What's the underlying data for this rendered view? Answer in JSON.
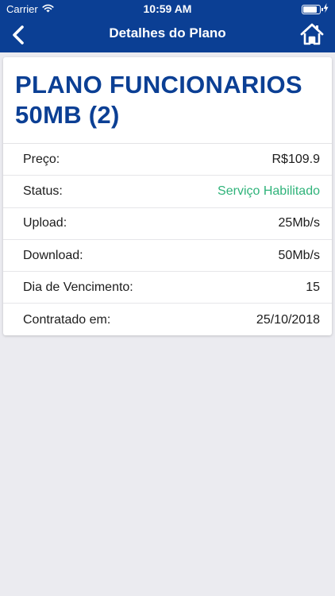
{
  "status_bar": {
    "carrier": "Carrier",
    "time": "10:59 AM"
  },
  "nav": {
    "title": "Detalhes do Plano",
    "back_icon": "chevron-left-icon",
    "home_icon": "home-icon"
  },
  "plan": {
    "title": "PLANO FUNCIONARIOS 50MB (2)",
    "details": [
      {
        "label": "Preço:",
        "value": "R$109.9"
      },
      {
        "label": "Status:",
        "value": "Serviço Habilitado"
      },
      {
        "label": "Upload:",
        "value": "25Mb/s"
      },
      {
        "label": "Download:",
        "value": "50Mb/s"
      },
      {
        "label": "Dia de Vencimento:",
        "value": "15"
      },
      {
        "label": "Contratado em:",
        "value": "25/10/2018"
      }
    ]
  },
  "colors": {
    "brand": "#0b3f94",
    "status_ok": "#2fb37a",
    "background": "#ebebf0"
  }
}
